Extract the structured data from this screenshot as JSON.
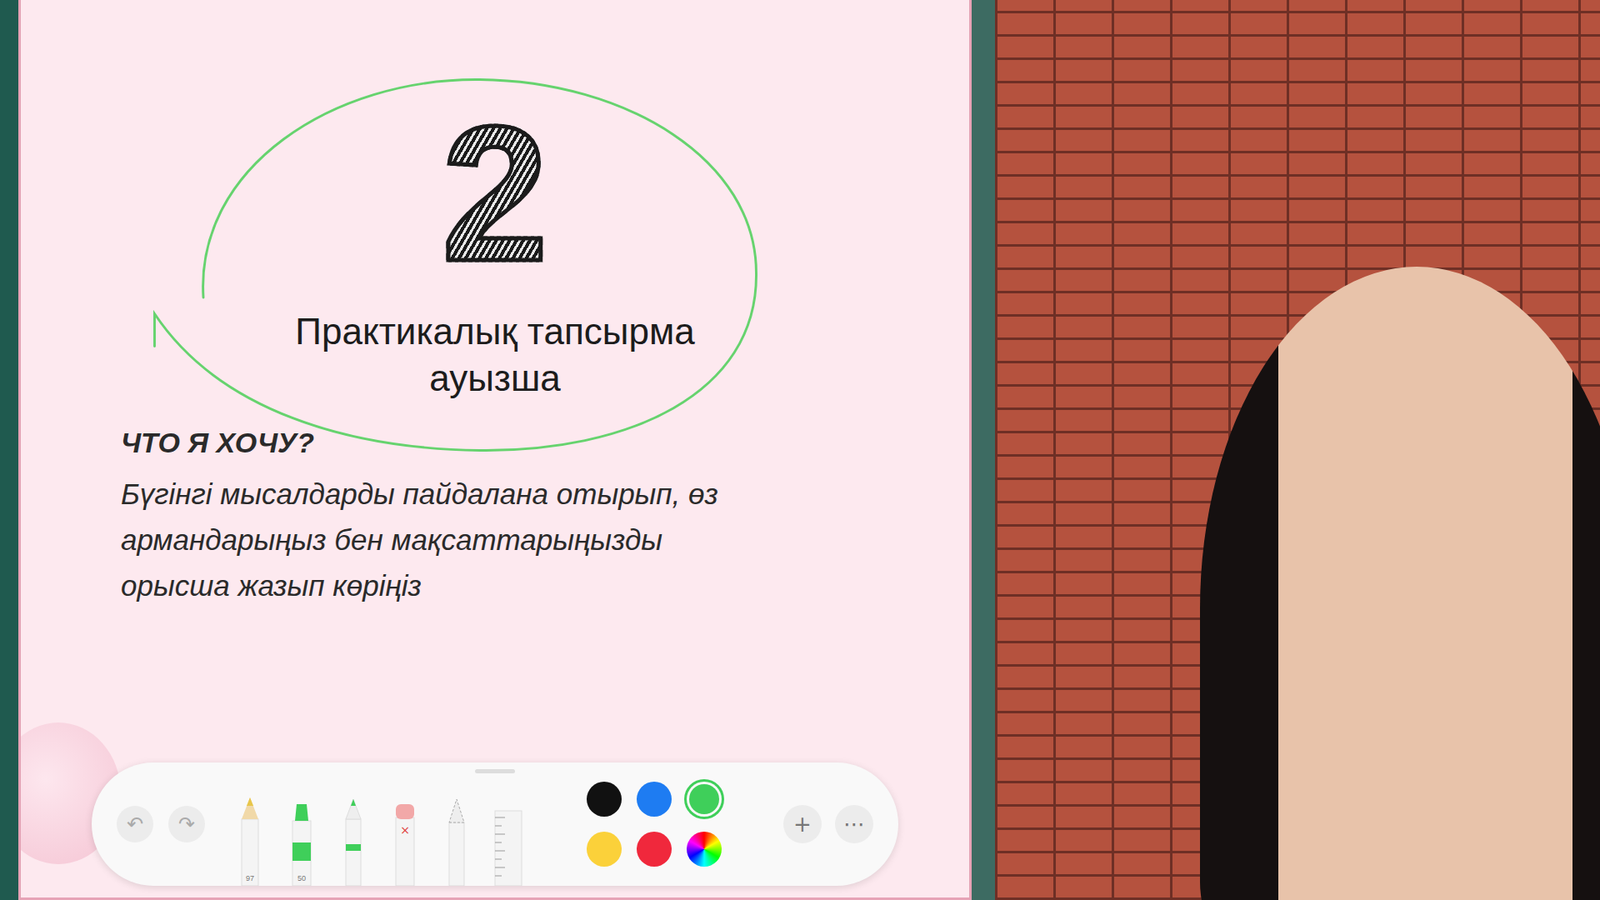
{
  "slide": {
    "number": "2",
    "title": [
      "Практикалық тапсырма",
      "ауызша"
    ],
    "heading": "ЧТО Я ХОЧУ?",
    "body": [
      "Бүгінгі мысалдарды пайдалана отырып, өз",
      "армандарыңыз бен мақсаттарыңызды",
      "орысша жазып көріңіз"
    ]
  },
  "toolbar": {
    "history": [
      {
        "label": "↶",
        "disabled": true
      },
      {
        "label": "↷",
        "disabled": true
      }
    ],
    "tools": [
      {
        "kind": "pencil",
        "label": "97"
      },
      {
        "kind": "marker",
        "label": "50"
      },
      {
        "kind": "pen",
        "label": ""
      },
      {
        "kind": "eraser",
        "label": ""
      },
      {
        "kind": "lasso",
        "label": ""
      },
      {
        "kind": "ruler",
        "label": ""
      }
    ],
    "colors": [
      {
        "color": "#111111",
        "selected": false
      },
      {
        "color": "#1e7cf2",
        "selected": false
      },
      {
        "color": "#3fcf5a",
        "selected": true
      },
      {
        "color": "#fbd13a",
        "selected": false
      },
      {
        "color": "#f0283c",
        "selected": false
      },
      {
        "color": "wheel",
        "selected": false
      }
    ],
    "actions": [
      "+",
      "⋯"
    ]
  }
}
